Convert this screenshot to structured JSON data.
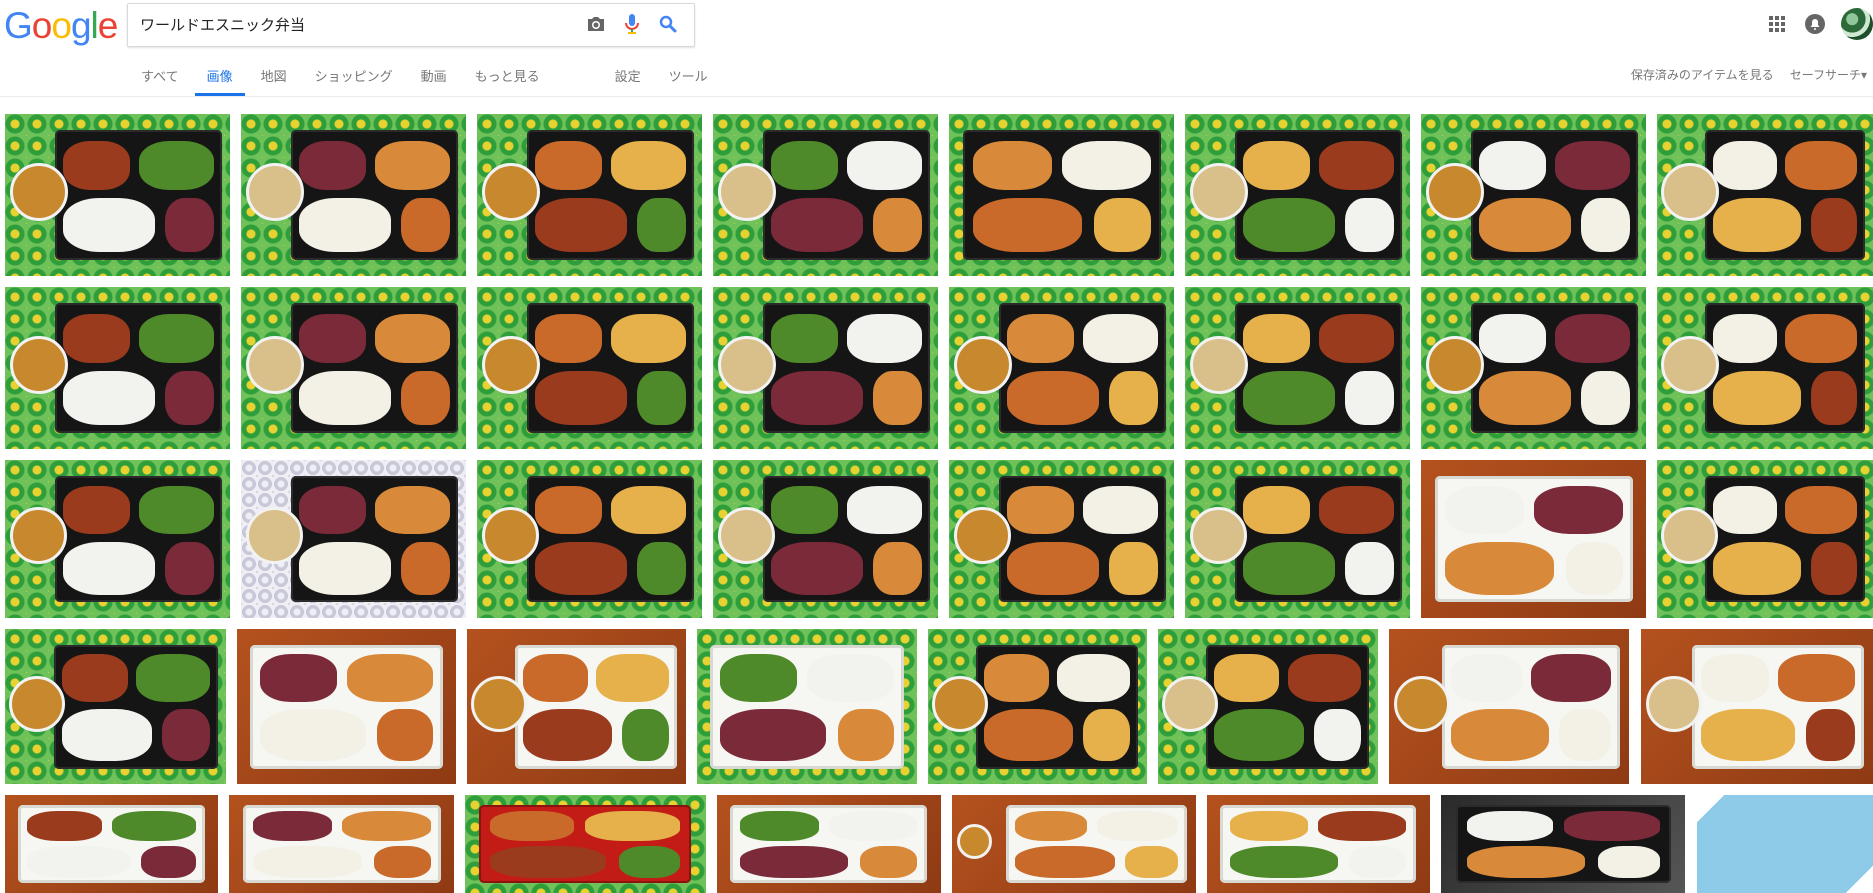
{
  "logo": {
    "letters": [
      "G",
      "o",
      "o",
      "g",
      "l",
      "e"
    ],
    "colors": [
      "#4285f4",
      "#ea4335",
      "#fbbc05",
      "#4285f4",
      "#34a853",
      "#ea4335"
    ]
  },
  "search": {
    "query": "ワールドエスニック弁当"
  },
  "tabs": [
    {
      "label": "すべて",
      "active": false
    },
    {
      "label": "画像",
      "active": true
    },
    {
      "label": "地図",
      "active": false
    },
    {
      "label": "ショッピング",
      "active": false
    },
    {
      "label": "動画",
      "active": false
    },
    {
      "label": "もっと見る",
      "active": false
    },
    {
      "label": "設定",
      "active": false
    },
    {
      "label": "ツール",
      "active": false
    }
  ],
  "right_links": {
    "saved": "保存済みのアイテムを見る",
    "safesearch": "セーフサーチ▾"
  },
  "colors": {
    "accent": "#1a73e8",
    "tab_text": "#777777"
  },
  "icons": {
    "camera": "camera-icon",
    "mic": "microphone-icon",
    "search": "search-icon",
    "apps": "apps-grid-icon",
    "notifications": "notifications-icon",
    "account": "account-avatar"
  },
  "results": [
    {
      "bg": "cloth",
      "tray": "black",
      "bowl": true
    },
    {
      "bg": "cloth",
      "tray": "black",
      "bowl": true
    },
    {
      "bg": "cloth",
      "tray": "black",
      "bowl": true
    },
    {
      "bg": "cloth",
      "tray": "black",
      "bowl": true
    },
    {
      "bg": "cloth",
      "tray": "black",
      "bowl": false
    },
    {
      "bg": "cloth",
      "tray": "black",
      "bowl": true
    },
    {
      "bg": "cloth",
      "tray": "black",
      "bowl": true
    },
    {
      "bg": "cloth",
      "tray": "black",
      "bowl": true
    },
    {
      "bg": "cloth",
      "tray": "black",
      "bowl": true
    },
    {
      "bg": "cloth",
      "tray": "black",
      "bowl": true
    },
    {
      "bg": "cloth",
      "tray": "black",
      "bowl": true
    },
    {
      "bg": "cloth",
      "tray": "black",
      "bowl": true
    },
    {
      "bg": "cloth",
      "tray": "black",
      "bowl": true
    },
    {
      "bg": "cloth",
      "tray": "black",
      "bowl": true
    },
    {
      "bg": "cloth",
      "tray": "black",
      "bowl": true
    },
    {
      "bg": "cloth",
      "tray": "black",
      "bowl": true
    },
    {
      "bg": "cloth",
      "tray": "black",
      "bowl": true
    },
    {
      "bg": "lace",
      "tray": "black",
      "bowl": true
    },
    {
      "bg": "cloth",
      "tray": "black",
      "bowl": true
    },
    {
      "bg": "cloth",
      "tray": "black",
      "bowl": true
    },
    {
      "bg": "cloth",
      "tray": "black",
      "bowl": true
    },
    {
      "bg": "cloth",
      "tray": "black",
      "bowl": true
    },
    {
      "bg": "wood",
      "tray": "white",
      "bowl": false
    },
    {
      "bg": "cloth",
      "tray": "black",
      "bowl": true
    },
    {
      "bg": "cloth",
      "tray": "black",
      "bowl": true
    },
    {
      "bg": "wood",
      "tray": "white",
      "bowl": false
    },
    {
      "bg": "wood",
      "tray": "white",
      "bowl": true
    },
    {
      "bg": "cloth",
      "tray": "white",
      "bowl": false
    },
    {
      "bg": "cloth",
      "tray": "black",
      "bowl": true
    },
    {
      "bg": "cloth",
      "tray": "black",
      "bowl": true
    },
    {
      "bg": "wood",
      "tray": "white",
      "bowl": true
    },
    {
      "bg": "wood",
      "tray": "white",
      "bowl": true
    },
    {
      "bg": "wood",
      "tray": "white",
      "bowl": false
    },
    {
      "bg": "wood",
      "tray": "white",
      "bowl": false
    },
    {
      "bg": "cloth",
      "tray": "red",
      "bowl": false
    },
    {
      "bg": "wood",
      "tray": "white",
      "bowl": false
    },
    {
      "bg": "wood",
      "tray": "white",
      "bowl": true
    },
    {
      "bg": "wood",
      "tray": "white",
      "bowl": false
    },
    {
      "bg": "dark",
      "tray": "black",
      "bowl": false
    },
    {
      "bg": "blue",
      "tray": "none",
      "bowl": false
    }
  ]
}
